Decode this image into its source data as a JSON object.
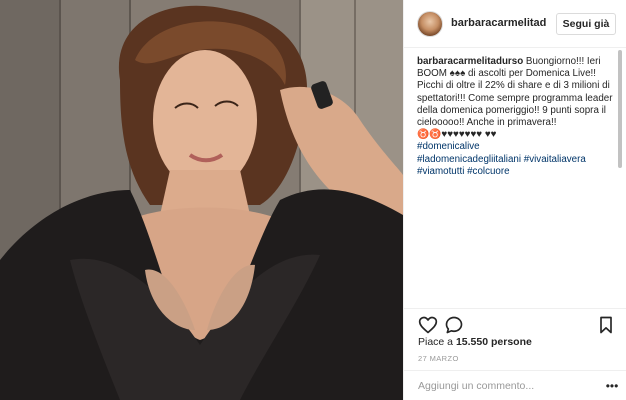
{
  "post": {
    "username": "barbaracarmelitadurso",
    "follow_label": "Segui già",
    "caption": {
      "author": "barbaracarmelitadurso",
      "text": "Buongiorno!!! Ieri BOOM ♠♠♠ di ascolti per Domenica Live!! Picchi di oltre il 22% di share e di 3 milioni di spettatori!!! Come sempre programma leader della domenica pomeriggio!! 9 punti sopra il cielooooo!! Anche in primavera!! ♉♉♥♥♥♥♥♥♥ ♥♥",
      "hashtags": [
        "#domenicalive",
        "#ladomenicadegliitaliani",
        "#vivaitaliavera",
        "#viamotutti",
        "#colcuore"
      ]
    },
    "likes_prefix": "Piace a",
    "likes_count": "15.550",
    "likes_suffix": "persone",
    "date": "27 MARZO",
    "comment_placeholder": "Aggiungi un commento...",
    "more_label": "•••"
  },
  "icons": {
    "like": "heart-icon",
    "comment": "comment-bubble-icon",
    "save": "bookmark-icon",
    "more": "more-options-icon"
  },
  "colors": {
    "hashtag": "#003569",
    "border": "#efefef",
    "muted": "#999999"
  }
}
